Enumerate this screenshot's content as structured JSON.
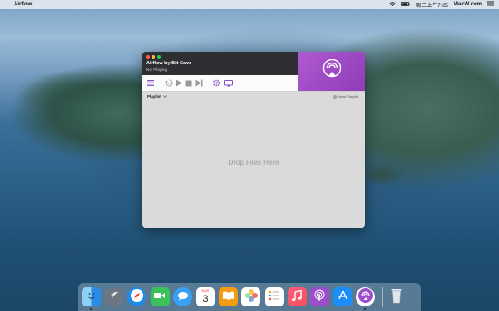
{
  "menubar": {
    "app_name": "Airflow",
    "clock": "周二上午7:05",
    "watermark": "MacW.com"
  },
  "window": {
    "title": "Airflow by Bit Cave",
    "status": "Not Playing"
  },
  "playlist": {
    "label": "Playlist",
    "new_playlist": "New Playlist",
    "drop_text": "Drop Files Here"
  },
  "dock": {
    "calendar_day": "3",
    "calendar_month": "MAR"
  },
  "colors": {
    "accent_purple": "#9b4dca",
    "titlebar": "#2d2f33",
    "toolbar_icon": "#8a4fc4"
  }
}
